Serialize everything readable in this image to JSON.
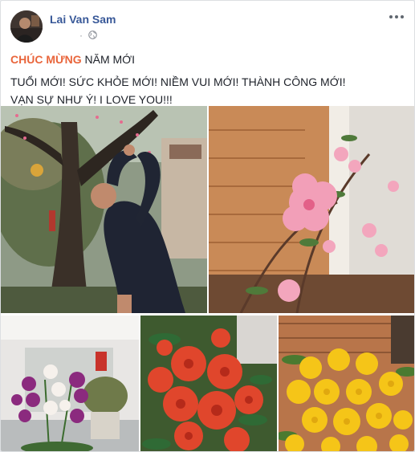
{
  "post": {
    "author": "Lai Van Sam",
    "time": "·",
    "privacy_icon": "globe-icon",
    "more_icon": "ellipsis-icon",
    "text": {
      "greeting_highlight": "CHÚC MỪNG",
      "greeting_rest": " NĂM MỚI",
      "line2": "TUỔI MỚI! SỨC KHỎE MỚI! NIỀM VUI MỚI! THÀNH CÔNG MỚI!",
      "line3": "VẠN SỰ NHƯ Ý! I LOVE YOU!!!"
    }
  },
  "colors": {
    "author": "#385898",
    "accent": "#e9653b",
    "body_text": "#1d2129",
    "meta": "#90949c"
  }
}
